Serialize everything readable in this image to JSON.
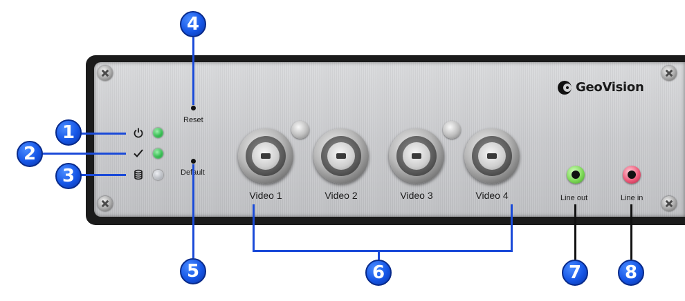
{
  "brand": {
    "logo_text": "GeoVision"
  },
  "panel_labels": {
    "reset": "Reset",
    "default": "Default",
    "line_out": "Line out",
    "line_in": "Line in"
  },
  "video_inputs": [
    "Video 1",
    "Video 2",
    "Video 3",
    "Video 4"
  ],
  "leds": [
    {
      "icon": "power-icon",
      "color": "#2db84a"
    },
    {
      "icon": "check-icon",
      "color": "#2db84a"
    },
    {
      "icon": "database-icon",
      "color": "#b9bcc2"
    }
  ],
  "callouts": [
    "1",
    "2",
    "3",
    "4",
    "5",
    "6",
    "7",
    "8"
  ],
  "colors": {
    "callout": "#1656e6",
    "line_out_jack": "#7ed957",
    "line_in_jack": "#ee5a7a"
  }
}
